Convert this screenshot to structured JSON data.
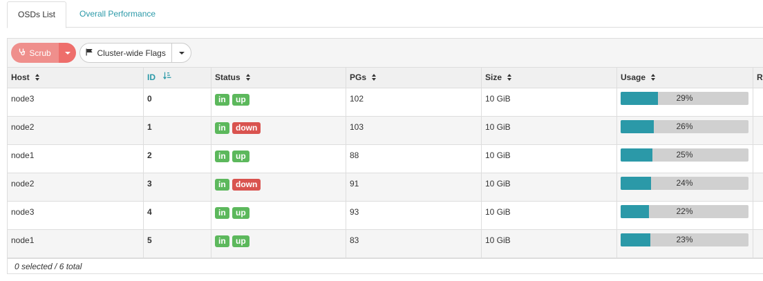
{
  "tabs": [
    {
      "label": "OSDs List",
      "active": true
    },
    {
      "label": "Overall Performance",
      "active": false
    }
  ],
  "toolbar": {
    "scrub_label": "Scrub",
    "scrub_icon": "stethoscope-icon",
    "flags_label": "Cluster-wide Flags",
    "flags_icon": "flag-icon"
  },
  "colors": {
    "accent": "#2b99a8",
    "scrub": "#ef8f8c",
    "status_ok": "#5cb85c",
    "status_bad": "#d9534f"
  },
  "table": {
    "columns": [
      "Host",
      "ID",
      "Status",
      "PGs",
      "Size",
      "Usage",
      "Re"
    ],
    "sorted_column": "ID",
    "rows": [
      {
        "host": "node3",
        "id": "0",
        "status": [
          "in",
          "up"
        ],
        "pgs": "102",
        "size": "10 GiB",
        "usage_pct": 29,
        "usage_label": "29%"
      },
      {
        "host": "node2",
        "id": "1",
        "status": [
          "in",
          "down"
        ],
        "pgs": "103",
        "size": "10 GiB",
        "usage_pct": 26,
        "usage_label": "26%"
      },
      {
        "host": "node1",
        "id": "2",
        "status": [
          "in",
          "up"
        ],
        "pgs": "88",
        "size": "10 GiB",
        "usage_pct": 25,
        "usage_label": "25%"
      },
      {
        "host": "node2",
        "id": "3",
        "status": [
          "in",
          "down"
        ],
        "pgs": "91",
        "size": "10 GiB",
        "usage_pct": 24,
        "usage_label": "24%"
      },
      {
        "host": "node3",
        "id": "4",
        "status": [
          "in",
          "up"
        ],
        "pgs": "93",
        "size": "10 GiB",
        "usage_pct": 22,
        "usage_label": "22%"
      },
      {
        "host": "node1",
        "id": "5",
        "status": [
          "in",
          "up"
        ],
        "pgs": "83",
        "size": "10 GiB",
        "usage_pct": 23,
        "usage_label": "23%"
      }
    ]
  },
  "footer": {
    "summary": "0 selected / 6 total"
  }
}
